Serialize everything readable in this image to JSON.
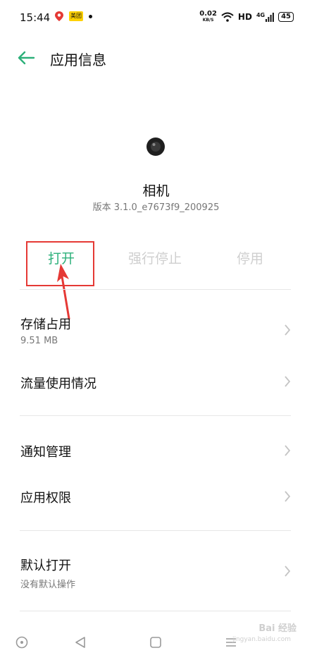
{
  "status_bar": {
    "time": "15:44",
    "badge": "美团",
    "net_speed_value": "0.02",
    "net_speed_unit": "KB/S",
    "hd": "HD",
    "signal": "4G",
    "battery": "45"
  },
  "header": {
    "title": "应用信息"
  },
  "app": {
    "name": "相机",
    "version": "版本 3.1.0_e7673f9_200925"
  },
  "actions": {
    "open": "打开",
    "force_stop": "强行停止",
    "disable": "停用"
  },
  "items": {
    "storage": {
      "title": "存储占用",
      "sub": "9.51 MB"
    },
    "data_usage": {
      "title": "流量使用情况"
    },
    "notifications": {
      "title": "通知管理"
    },
    "permissions": {
      "title": "应用权限"
    },
    "default_open": {
      "title": "默认打开",
      "sub": "没有默认操作"
    }
  },
  "watermark": {
    "text": "Bai 经验",
    "sub": "jingyan.baidu.com"
  },
  "colors": {
    "accent": "#2db07a",
    "highlight": "#e53935",
    "disabled": "#cfcfcf"
  }
}
